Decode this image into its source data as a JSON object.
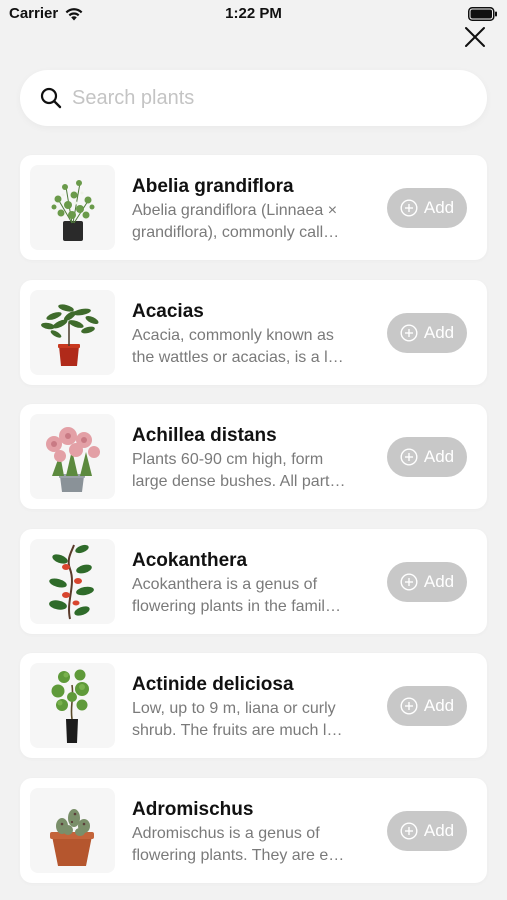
{
  "status_bar": {
    "carrier": "Carrier",
    "time": "1:22 PM"
  },
  "search": {
    "placeholder": "Search plants",
    "value": ""
  },
  "plants": [
    {
      "name": "Abelia grandiflora",
      "desc_line1": "Abelia grandiflora (Linnaea ×",
      "desc_line2": "grandiflora), commonly call…",
      "add_label": "Add",
      "icon": "abelia-plant"
    },
    {
      "name": "Acacias",
      "desc_line1": "Acacia, commonly known as",
      "desc_line2": "the wattles or acacias, is a l…",
      "add_label": "Add",
      "icon": "acacia-plant"
    },
    {
      "name": "Achillea distans",
      "desc_line1": "Plants 60-90 cm high, form",
      "desc_line2": "large dense bushes. All part…",
      "add_label": "Add",
      "icon": "achillea-plant"
    },
    {
      "name": "Acokanthera",
      "desc_line1": "Acokanthera is a genus of",
      "desc_line2": "flowering plants in the famil…",
      "add_label": "Add",
      "icon": "acokanthera-plant"
    },
    {
      "name": "Actinide deliciosa",
      "desc_line1": "Low, up to 9 m, liana or curly",
      "desc_line2": "shrub. The fruits are much l…",
      "add_label": "Add",
      "icon": "actinidia-plant"
    },
    {
      "name": "Adromischus",
      "desc_line1": "Adromischus is a genus of",
      "desc_line2": "flowering plants. They are e…",
      "add_label": "Add",
      "icon": "adromischus-plant"
    }
  ],
  "colors": {
    "background": "#f2f2f2",
    "card": "#ffffff",
    "add_button": "#c8c8c8",
    "desc_text": "#7a7a7a"
  }
}
